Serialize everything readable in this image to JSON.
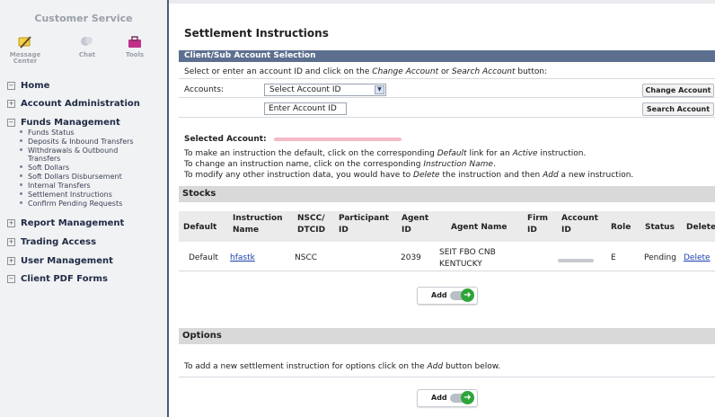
{
  "sidebar": {
    "title": "Customer Service",
    "icons": [
      {
        "icon": "message-center-icon",
        "label_line1": "Message",
        "label_line2": "Center"
      },
      {
        "icon": "chat-icon",
        "label_line1": "Chat",
        "label_line2": ""
      },
      {
        "icon": "tools-icon",
        "label_line1": "Tools",
        "label_line2": ""
      }
    ],
    "sections": [
      {
        "label": "Home",
        "toggle": "−"
      },
      {
        "label": "Account Administration",
        "toggle": "+"
      },
      {
        "label": "Funds Management",
        "toggle": "−"
      },
      {
        "label": "Report Management",
        "toggle": "+"
      },
      {
        "label": "Trading Access",
        "toggle": "+"
      },
      {
        "label": "User Management",
        "toggle": "+"
      },
      {
        "label": "Client PDF Forms",
        "toggle": "−"
      }
    ],
    "funds_items": [
      "Funds Status",
      "Deposits & Inbound Transfers",
      "Withdrawals & Outbound",
      "Transfers",
      "Soft Dollars",
      "Soft Dollars Disbursement",
      "Internal Transfers",
      "Settlement Instructions",
      "Confirm Pending Requests"
    ]
  },
  "main": {
    "title": "Settlement Instructions",
    "selection_header": "Client/Sub Account Selection",
    "select_prompt_pre": "Select or enter an account ID and click on the ",
    "select_prompt_change": "Change Account",
    "select_prompt_or": " or ",
    "select_prompt_search": "Search Account",
    "select_prompt_post": " button:",
    "accounts_label": "Accounts:",
    "account_select_value": "Select Account ID",
    "account_input_value": "Enter Account ID",
    "change_account_button": "Change Account",
    "search_account_button": "Search Account",
    "selected_account_label": "Selected Account:",
    "instruction_line1_pre": "To make an instruction the default, click on the corresponding ",
    "instruction_line1_default": "Default",
    "instruction_line1_mid": " link for an ",
    "instruction_line1_active": "Active",
    "instruction_line1_post": " instruction.",
    "instruction_line2_pre": "To change an instruction name, click on the corresponding ",
    "instruction_line2_name": "Instruction Name",
    "instruction_line2_post": ".",
    "instruction_line3_pre": "To modify any other instruction data, you would have to ",
    "instruction_line3_delete": "Delete",
    "instruction_line3_mid": " the instruction and then ",
    "instruction_line3_add": "Add",
    "instruction_line3_post": " a new instruction.",
    "stocks_header": "Stocks",
    "table_columns": [
      [
        "Default",
        ""
      ],
      [
        "Instruction",
        "Name"
      ],
      [
        "NSCC/",
        "DTCID"
      ],
      [
        "Participant",
        "ID"
      ],
      [
        "Agent",
        "ID"
      ],
      [
        "Agent Name",
        ""
      ],
      [
        "Firm",
        "ID"
      ],
      [
        "Account",
        "ID"
      ],
      [
        "Role",
        ""
      ],
      [
        "Status",
        ""
      ],
      [
        "Delete",
        ""
      ]
    ],
    "row": {
      "default": "Default",
      "instruction_name": "hfastk",
      "nscc": "NSCC",
      "participant_id": "",
      "agent_id": "2039",
      "agent_name_line1": "SEIT FBO CNB",
      "agent_name_line2": "KENTUCKY",
      "firm_id": "",
      "role": "E",
      "status": "Pending",
      "delete": "Delete"
    },
    "add_button": "Add",
    "options_header": "Options",
    "options_text_pre": "To add a new settlement instruction for options click on the ",
    "options_text_add": "Add",
    "options_text_post": " button below."
  },
  "colors": {
    "sidebar_bg": "#f1f2f4",
    "section_header_bg": "#5c6f8f",
    "gray_bar_bg": "#d9d9d9",
    "link": "#1a3fb0",
    "add_icon": "#2ea539"
  }
}
